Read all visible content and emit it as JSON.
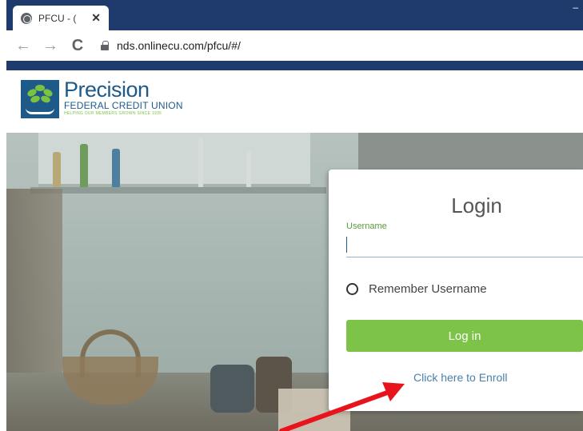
{
  "browser": {
    "tab_title": "PFCU - (",
    "url": "nds.onlinecu.com/pfcu/#/"
  },
  "brand": {
    "name": "Precision",
    "subtitle": "FEDERAL CREDIT UNION",
    "tagline": "HELPING OUR MEMBERS GROWN SINCE 1935",
    "colors": {
      "primary": "#1d5a8a",
      "accent_green": "#7dc348",
      "chrome_navy": "#1f3b6e",
      "annotation_red": "#e8141b"
    }
  },
  "login": {
    "title": "Login",
    "username_label": "Username",
    "username_value": "",
    "remember_label": "Remember Username",
    "remember_checked": false,
    "login_button": "Log in",
    "enroll_link": "Click here to Enroll"
  },
  "icons": {
    "tab_favicon": "globe-icon",
    "tab_close": "close-icon",
    "back": "arrow-left-icon",
    "forward": "arrow-right-icon",
    "reload": "reload-icon",
    "lock": "lock-icon",
    "annotation": "arrow-icon"
  },
  "glyphs": {
    "close": "✕",
    "back": "←",
    "forward": "→",
    "reload": "C",
    "minimize": "–"
  }
}
